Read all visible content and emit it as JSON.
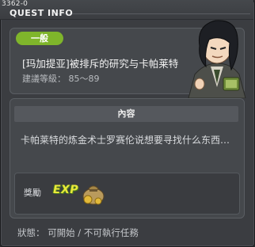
{
  "window": {
    "quest_id": "3362-0",
    "title": "QUEST INFO"
  },
  "summary": {
    "category_badge": "一般",
    "quest_name": "[玛加提亚]被排斥的研究与卡帕莱特",
    "level_text": "建議等級： 85～89",
    "portrait_icon": "npc-portrait-icon"
  },
  "details": {
    "section_header": "內容",
    "description": "卡帕莱特的炼金术士罗赛伦说想要寻找什么东西…",
    "reward_label": "獎勵",
    "reward_items": [
      {
        "icon": "exp-icon",
        "text": "EXP"
      },
      {
        "icon": "meso-bag-icon"
      }
    ]
  },
  "status": {
    "text": "狀態： 可開始 / 不可執行任務"
  },
  "colors": {
    "badge_green": "#7fb52b",
    "exp_yellow": "#e9e83a"
  }
}
